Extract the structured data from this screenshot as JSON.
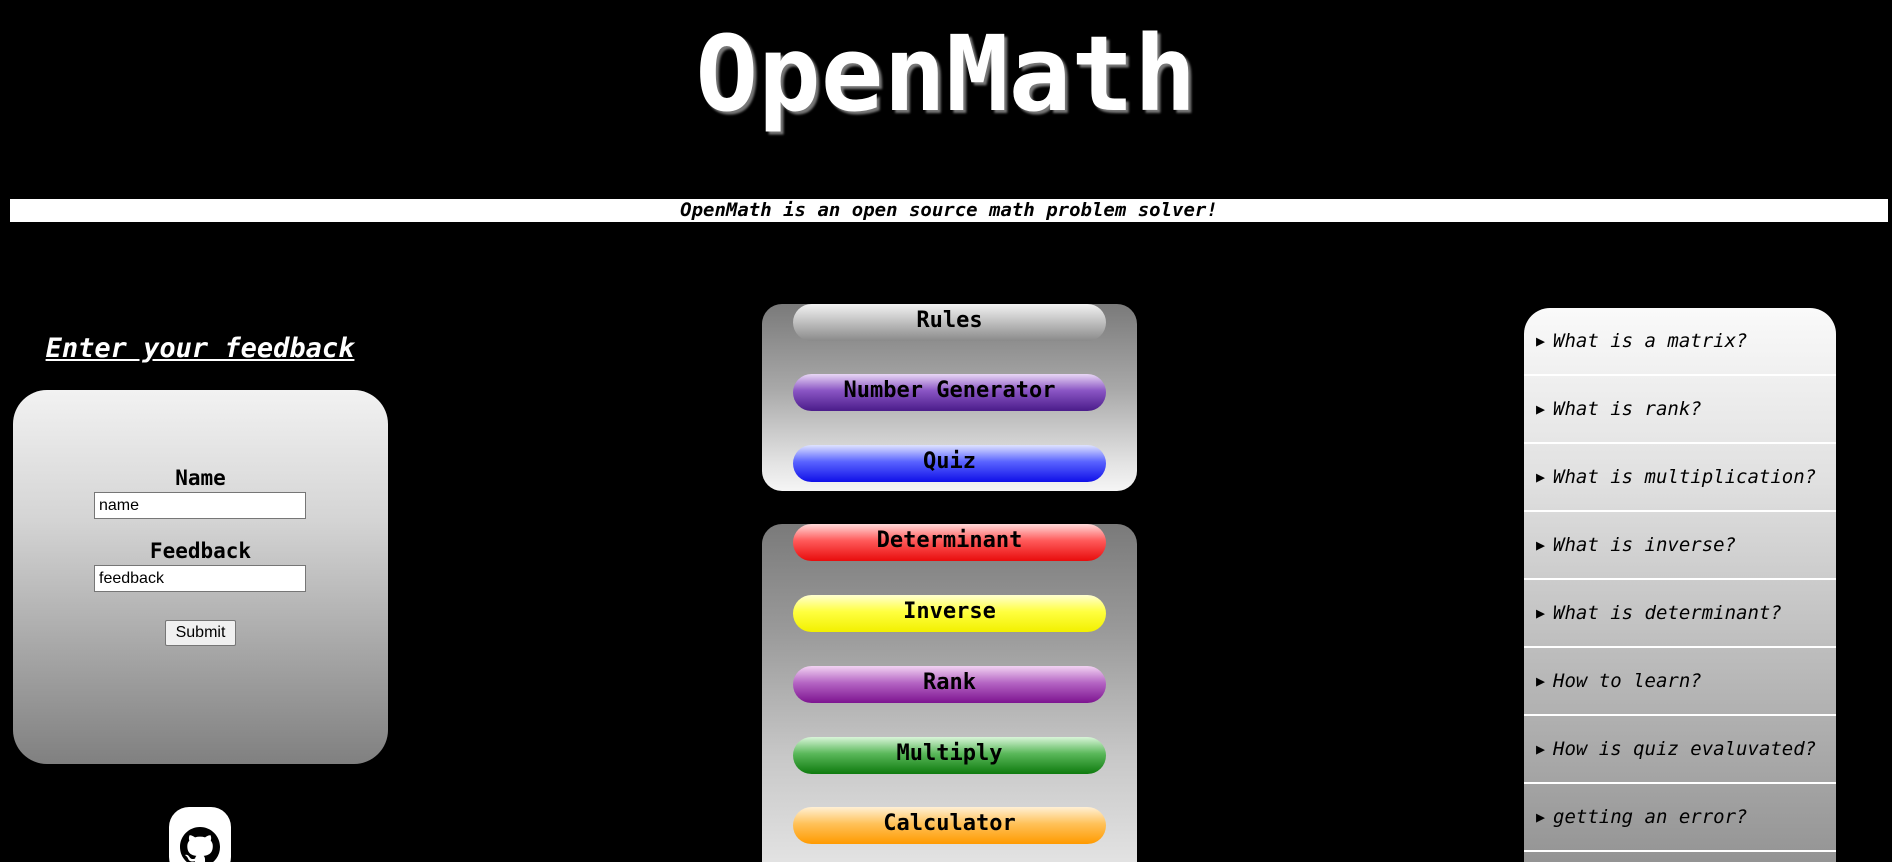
{
  "header": {
    "title": "OpenMath",
    "tagline": "OpenMath is an open source math problem solver!"
  },
  "feedback": {
    "heading": "Enter your feedback",
    "name_label": "Name",
    "name_value": "name",
    "feedback_label": "Feedback",
    "feedback_value": "feedback",
    "submit_label": "Submit"
  },
  "menu_top": {
    "items": [
      {
        "label": "Rules",
        "color": "#9a9a9a"
      },
      {
        "label": "Number Generator",
        "color": "#6a35a8"
      },
      {
        "label": "Quiz",
        "color": "#1a1aff"
      }
    ]
  },
  "menu_bottom": {
    "items": [
      {
        "label": "Determinant",
        "color": "#ff2a2a"
      },
      {
        "label": "Inverse",
        "color": "#ffff00"
      },
      {
        "label": "Rank",
        "color": "#9c3aab"
      },
      {
        "label": "Multiply",
        "color": "#2e9a2e"
      },
      {
        "label": "Calculator",
        "color": "#ffaa20"
      }
    ]
  },
  "faq": {
    "items": [
      {
        "label": "What is a matrix?"
      },
      {
        "label": "What is rank?"
      },
      {
        "label": "What is multiplication?"
      },
      {
        "label": "What is inverse?"
      },
      {
        "label": "What is determinant?"
      },
      {
        "label": "How to learn?"
      },
      {
        "label": "How is quiz evaluvated?"
      },
      {
        "label": "getting an error?"
      }
    ]
  },
  "icons": {
    "faq_arrow": "triangle-right-icon",
    "github": "github-icon"
  }
}
